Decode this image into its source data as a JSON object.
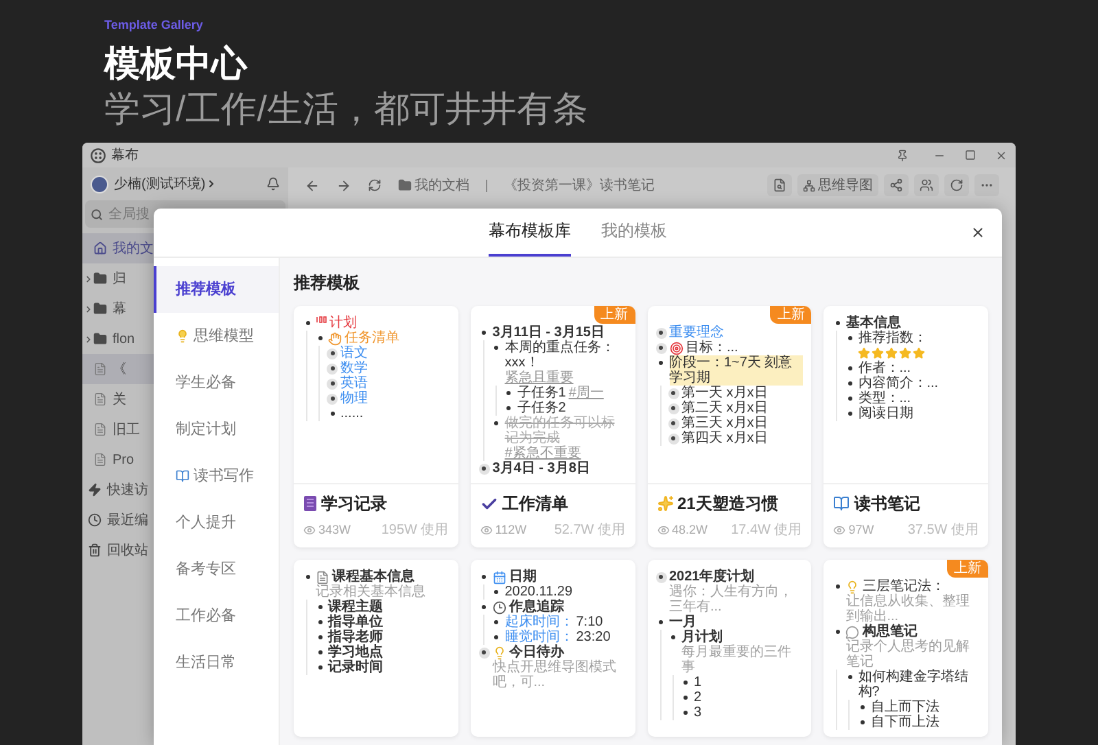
{
  "header": {
    "eyebrow": "Template Gallery",
    "title": "模板中心",
    "subtitle": "学习/工作/生活，都可井井有条"
  },
  "window": {
    "title": "幕布",
    "user": "少楠(测试环境)",
    "search_placeholder": "全局搜",
    "tree": [
      {
        "text": "我的文",
        "kind": "home",
        "selected": true,
        "children": [
          {
            "text": "归",
            "kind": "folder",
            "expanded": false,
            "selected": false
          },
          {
            "text": "幕",
            "kind": "folder",
            "expanded": false,
            "selected": false
          },
          {
            "text": "flon",
            "kind": "folder",
            "expanded": false,
            "selected": false
          },
          {
            "text": "《",
            "kind": "doc",
            "selected": true
          },
          {
            "text": "关",
            "kind": "doc",
            "selected": false
          },
          {
            "text": "旧工",
            "kind": "doc",
            "selected": false
          },
          {
            "text": "Pro",
            "kind": "doc",
            "selected": false
          }
        ]
      }
    ],
    "quick": [
      {
        "text": "快速访",
        "kind": "bolt"
      },
      {
        "text": "最近编",
        "kind": "recent"
      },
      {
        "text": "回收站",
        "kind": "trash"
      }
    ],
    "toolbar": {
      "folder": "我的文档",
      "document": "《投资第一课》读书笔记",
      "mindmap": "思维导图"
    }
  },
  "modal": {
    "tabs": [
      {
        "label": "幕布模板库",
        "selected": true
      },
      {
        "label": "我的模板",
        "selected": false
      }
    ],
    "nav": [
      {
        "text": "推荐模板",
        "selected": true
      },
      {
        "text": "思维模型",
        "kind": "bulb",
        "selected": false
      },
      {
        "text": "学生必备",
        "selected": false
      },
      {
        "text": "制定计划",
        "selected": false
      },
      {
        "text": "读书写作",
        "kind": "book",
        "selected": false
      },
      {
        "text": "个人提升",
        "selected": false
      },
      {
        "text": "备考专区",
        "selected": false
      },
      {
        "text": "工作必备",
        "selected": false
      },
      {
        "text": "生活日常",
        "selected": false
      }
    ],
    "section_title": "推荐模板",
    "cards": [
      {
        "title": "学习记录",
        "kind": "notebook",
        "views": "343W",
        "uses": "195W 使用",
        "preview": [
          {
            "text": "计划",
            "collapsed": false,
            "color": "#e5393f",
            "kind": "hundred",
            "children": [
              {
                "text": "任务清单",
                "collapsed": false,
                "color": "#f0962e",
                "kind": "clap",
                "children": [
                  {
                    "text": "语文",
                    "collapsed": true,
                    "color": "#3d8ef0"
                  },
                  {
                    "text": "数学",
                    "collapsed": true,
                    "color": "#3d8ef0"
                  },
                  {
                    "text": "英语",
                    "collapsed": true,
                    "color": "#3d8ef0"
                  },
                  {
                    "text": "物理",
                    "collapsed": true,
                    "color": "#3d8ef0"
                  },
                  {
                    "text": "......",
                    "collapsed": false
                  }
                ]
              }
            ]
          }
        ]
      },
      {
        "title": "工作清单",
        "kind": "check",
        "views": "112W",
        "uses": "52.7W 使用",
        "badge": "上新",
        "preview": [
          {
            "text": "3月11日 - 3月15日",
            "collapsed": false,
            "bold": true,
            "children": [
              {
                "text": "本周的重点任务：xxx！",
                "tag": "紧急且重要",
                "collapsed": false,
                "children": [
                  {
                    "text": "子任务1",
                    "tag": "#周一",
                    "collapsed": false
                  },
                  {
                    "text": "子任务2",
                    "collapsed": false
                  }
                ]
              },
              {
                "text": "做完的任务可以标记为完成",
                "tag": "#紧急不重要",
                "collapsed": false,
                "done": true
              }
            ]
          },
          {
            "text": "3月4日 - 3月8日",
            "collapsed": true,
            "bold": true
          }
        ]
      },
      {
        "title": "21天塑造习惯",
        "kind": "sparkles",
        "views": "48.2W",
        "uses": "17.4W 使用",
        "badge": "上新",
        "preview": [
          {
            "text": "重要理念",
            "collapsed": true,
            "color": "#3d8ef0"
          },
          {
            "text": "目标：...",
            "collapsed": true,
            "kind": "target"
          },
          {
            "text": "阶段一：1~7天 刻意学习期",
            "collapsed": false,
            "highlight": true,
            "children": [
              {
                "text": "第一天 x月x日",
                "collapsed": true
              },
              {
                "text": "第二天 x月x日",
                "collapsed": true
              },
              {
                "text": "第三天 x月x日",
                "collapsed": true
              },
              {
                "text": "第四天 x月x日",
                "collapsed": true
              }
            ]
          }
        ]
      },
      {
        "title": "读书笔记",
        "kind": "open-book",
        "views": "97W",
        "uses": "37.5W 使用",
        "preview": [
          {
            "text": "基本信息",
            "collapsed": false,
            "bold": true,
            "children": [
              {
                "text": "推荐指数：",
                "stars": 5,
                "collapsed": false
              },
              {
                "text": "作者：...",
                "collapsed": false
              },
              {
                "text": "内容简介：...",
                "collapsed": false
              },
              {
                "text": "类型：...",
                "collapsed": false
              },
              {
                "text": "阅读日期",
                "collapsed": false
              }
            ]
          }
        ]
      },
      {
        "preview": [
          {
            "text": "课程基本信息",
            "kind": "memo",
            "collapsed": false,
            "bold": true,
            "note": "记录相关基本信息",
            "children": [
              {
                "text": "课程主题",
                "collapsed": false,
                "bold": true
              },
              {
                "text": "指导单位",
                "collapsed": false,
                "bold": true
              },
              {
                "text": "指导老师",
                "collapsed": false,
                "bold": true
              },
              {
                "text": "学习地点",
                "collapsed": false,
                "bold": true
              },
              {
                "text": "记录时间",
                "collapsed": false,
                "bold": true
              }
            ]
          }
        ]
      },
      {
        "preview": [
          {
            "text": "日期",
            "kind": "calendar",
            "collapsed": false,
            "bold": true,
            "children": [
              {
                "text": "2020.11.29",
                "collapsed": false
              }
            ]
          },
          {
            "text": "作息追踪",
            "kind": "clock",
            "collapsed": false,
            "bold": true,
            "children": [
              {
                "label": "起床时间：",
                "text": "7:10",
                "collapsed": false
              },
              {
                "label": "睡觉时间：",
                "text": "23:20",
                "collapsed": false
              }
            ]
          },
          {
            "text": "今日待办",
            "kind": "bulb",
            "collapsed": true,
            "bold": true,
            "note": "快点开思维导图模式吧，可..."
          }
        ]
      },
      {
        "preview": [
          {
            "text": "2021年度计划",
            "collapsed": true,
            "bold": true,
            "note": "遇你：人生有方向，三年有..."
          },
          {
            "text": "一月",
            "collapsed": false,
            "bold": true,
            "children": [
              {
                "text": "月计划",
                "collapsed": false,
                "bold": true,
                "note": "每月最重要的三件事",
                "children": [
                  {
                    "text": "1",
                    "collapsed": false
                  },
                  {
                    "text": "2",
                    "collapsed": false
                  },
                  {
                    "text": "3",
                    "collapsed": false
                  }
                ]
              }
            ]
          }
        ]
      },
      {
        "badge": "上新",
        "preview": [
          {
            "text": "三层笔记法：",
            "kind": "bulb",
            "collapsed": false,
            "note": "让信息从收集、整理到输出..."
          },
          {
            "text": "构思笔记",
            "kind": "bubble",
            "collapsed": false,
            "bold": true,
            "note": "记录个人思考的见解笔记",
            "children": [
              {
                "text": "如何构建金字塔结构?",
                "collapsed": false,
                "children": [
                  {
                    "text": "自上而下法",
                    "collapsed": false
                  },
                  {
                    "text": "自下而上法",
                    "collapsed": false
                  }
                ]
              }
            ]
          }
        ]
      }
    ]
  }
}
